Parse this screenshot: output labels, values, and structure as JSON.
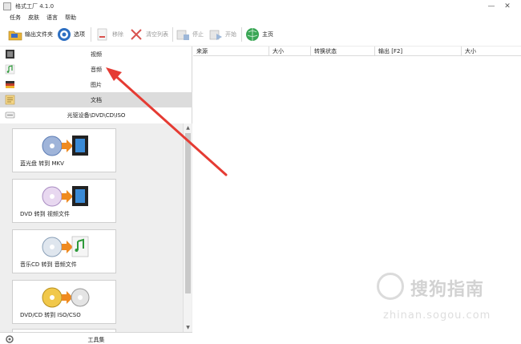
{
  "window": {
    "title": "格式工厂 4.1.0",
    "minimize_glyph": "—",
    "close_glyph": "✕"
  },
  "menu": [
    {
      "label": "任务"
    },
    {
      "label": "皮肤"
    },
    {
      "label": "语言"
    },
    {
      "label": "帮助"
    }
  ],
  "toolbar": {
    "output_folder": "输出文件夹",
    "options": "选项",
    "remove": "移除",
    "clear_list": "清空列表",
    "stop": "停止",
    "start": "开始",
    "home": "主页"
  },
  "sidebar": {
    "categories": [
      {
        "label": "视频",
        "icon": "film-icon"
      },
      {
        "label": "音频",
        "icon": "music-icon"
      },
      {
        "label": "图片",
        "icon": "picture-icon"
      },
      {
        "label": "文档",
        "icon": "document-icon"
      },
      {
        "label": "光驱设备\\DVD\\CD\\ISO",
        "icon": "disc-drive-icon"
      }
    ],
    "active_index": 3,
    "cards": [
      {
        "label": "蓝光盘 转到 MKV",
        "icon": "bluray-to-video-icon"
      },
      {
        "label": "DVD 转到 视频文件",
        "icon": "dvd-to-video-icon"
      },
      {
        "label": "音乐CD 转到 音频文件",
        "icon": "cd-to-audio-icon"
      },
      {
        "label": "DVD/CD 转到 ISO/CSO",
        "icon": "disc-to-iso-icon"
      }
    ],
    "toolbox_label": "工具集"
  },
  "file_list": {
    "columns": [
      "来源",
      "大小",
      "转换状态",
      "输出 [F2]",
      "大小"
    ]
  },
  "watermark": {
    "brand": "搜狗指南",
    "url": "zhinan.sogou.com"
  },
  "colors": {
    "accent_arrow": "#e53b33",
    "active_row": "#dcdcdc",
    "panel_bg": "#eeeeee"
  }
}
